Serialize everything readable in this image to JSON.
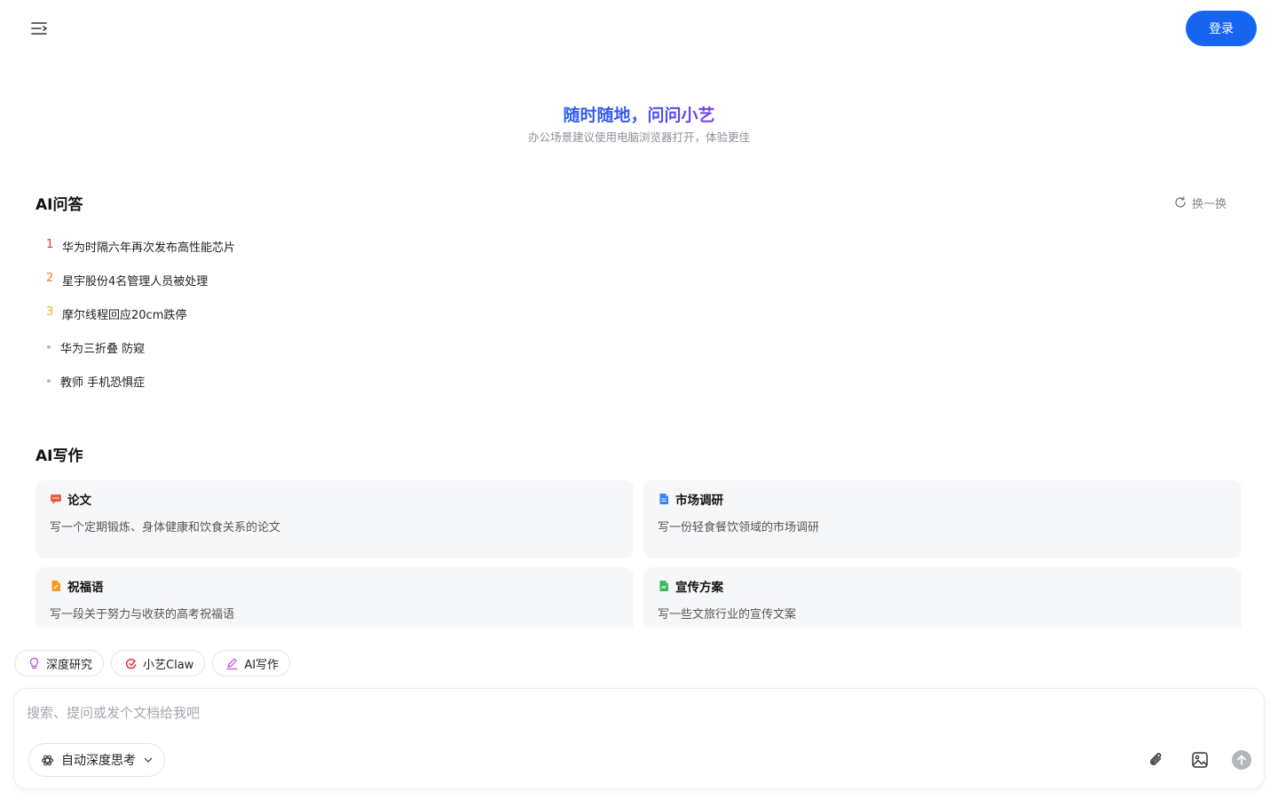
{
  "header": {
    "menu_icon": "menu-collapse-icon",
    "login_label": "登录",
    "accent": "#1565f0"
  },
  "hero": {
    "title": "随时随地，问问小艺",
    "subtitle": "办公场景建议使用电脑浏览器打开，体验更佳"
  },
  "qa": {
    "title": "AI问答",
    "refresh_label": "换一换",
    "items": [
      {
        "rank": "1",
        "text": "华为时隔六年再次发布高性能芯片",
        "rank_color": "#e8333b"
      },
      {
        "rank": "2",
        "text": "星宇股份4名管理人员被处理",
        "rank_color": "#f07a1c"
      },
      {
        "rank": "3",
        "text": "摩尔线程回应20cm跌停",
        "rank_color": "#f2b21b"
      },
      {
        "rank": "",
        "text": "华为三折叠 防窥"
      },
      {
        "rank": "",
        "text": "教师 手机恐惧症"
      }
    ]
  },
  "writing": {
    "title": "AI写作",
    "cards": [
      {
        "icon": "thesis-icon",
        "title": "论文",
        "desc": "写一个定期锻炼、身体健康和饮食关系的论文"
      },
      {
        "icon": "market-research-icon",
        "title": "市场调研",
        "desc": "写一份轻食餐饮领域的市场调研"
      },
      {
        "icon": "blessing-icon",
        "title": "祝福语",
        "desc": "写一段关于努力与收获的高考祝福语"
      },
      {
        "icon": "promo-plan-icon",
        "title": "宣传方案",
        "desc": "写一些文旅行业的宣传文案"
      }
    ]
  },
  "chips": [
    {
      "icon": "lightbulb-icon",
      "label": "深度研究"
    },
    {
      "icon": "claw-icon",
      "label": "小艺Claw"
    },
    {
      "icon": "pen-icon",
      "label": "AI写作"
    }
  ],
  "composer": {
    "placeholder": "搜索、提问或发个文档给我吧",
    "value": "",
    "mode_label": "自动深度思考",
    "attach_icon": "paperclip-icon",
    "image_icon": "image-icon",
    "send_icon": "send-arrow-icon"
  }
}
